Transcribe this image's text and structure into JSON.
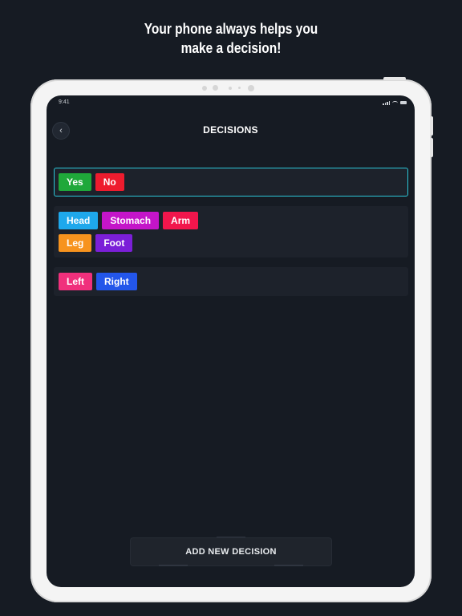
{
  "promo": {
    "line1": "Your phone always helps you",
    "line2": "make a decision!"
  },
  "status_bar": {
    "time": "9:41",
    "icons": [
      "signal-icon",
      "wifi-icon",
      "battery-icon"
    ]
  },
  "nav": {
    "back_icon": "chevron-left-icon",
    "title": "DECISIONS"
  },
  "decisions": [
    {
      "selected": true,
      "rows": [
        [
          {
            "label": "Yes",
            "color": "#1fa83a"
          },
          {
            "label": "No",
            "color": "#ee1c2e"
          }
        ]
      ]
    },
    {
      "selected": false,
      "rows": [
        [
          {
            "label": "Head",
            "color": "#1ea8ec"
          },
          {
            "label": "Stomach",
            "color": "#c415c9"
          },
          {
            "label": "Arm",
            "color": "#f2164c"
          }
        ],
        [
          {
            "label": "Leg",
            "color": "#f7931e"
          },
          {
            "label": "Foot",
            "color": "#7b1fd8"
          }
        ]
      ]
    },
    {
      "selected": false,
      "rows": [
        [
          {
            "label": "Left",
            "color": "#f0307c"
          },
          {
            "label": "Right",
            "color": "#2356ea"
          }
        ]
      ]
    }
  ],
  "add_button": {
    "label": "ADD NEW DECISION"
  },
  "colors": {
    "background": "#161b23",
    "card": "#1d222b",
    "selected_border": "#2cc6d8"
  }
}
